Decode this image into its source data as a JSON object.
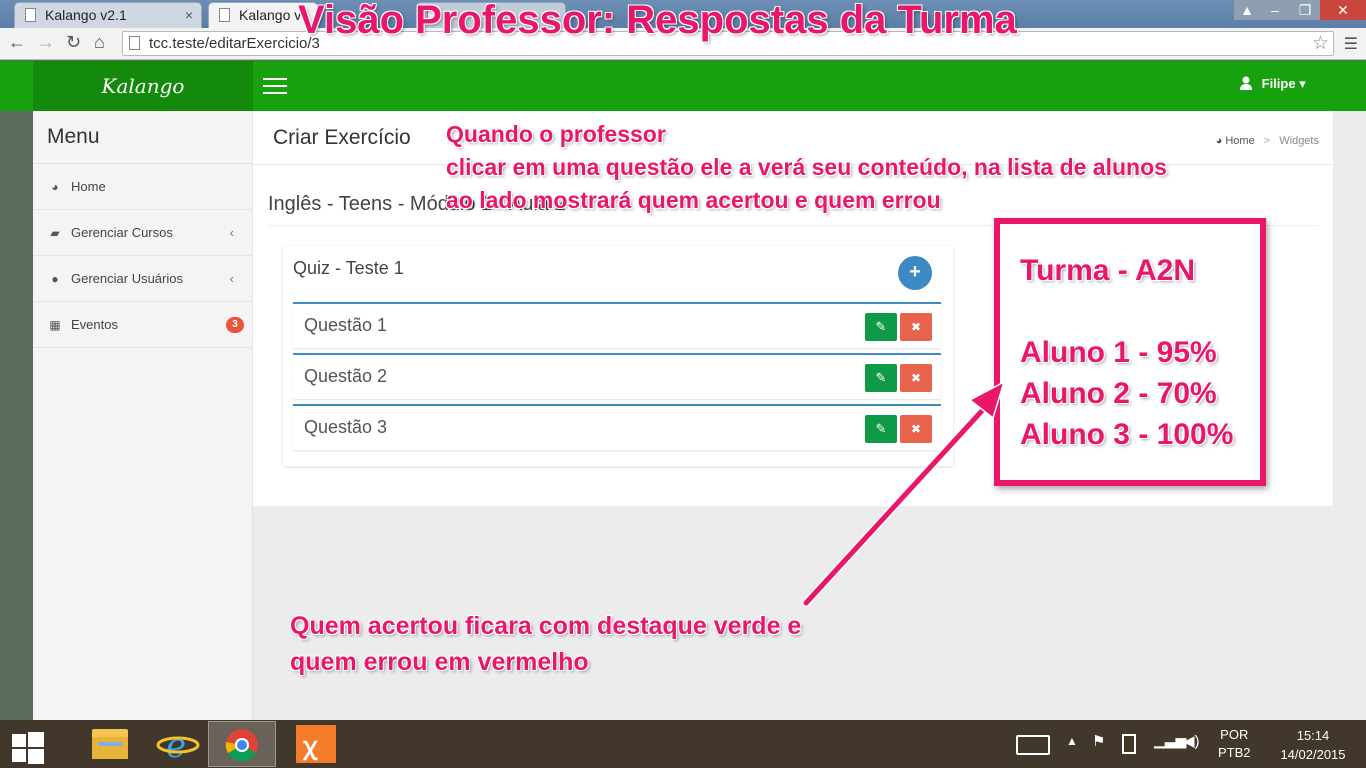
{
  "browser": {
    "tabs": [
      {
        "label": "Kalango v2.1",
        "close": "×"
      },
      {
        "label": "Kalango v",
        "close": ""
      }
    ],
    "url": "tcc.teste/editarExercicio/3",
    "window_colors": {
      "close": "#c9463d"
    }
  },
  "header": {
    "brand": "Kalango",
    "user": "Filipe",
    "accent": "#17a10f"
  },
  "sidebar": {
    "title": "Menu",
    "items": [
      {
        "label": "Home",
        "icon": "dashboard-icon"
      },
      {
        "label": "Gerenciar Cursos",
        "icon": "graduation-cap-icon",
        "chevron": "‹"
      },
      {
        "label": "Gerenciar Usuários",
        "icon": "user-icon",
        "chevron": "‹"
      },
      {
        "label": "Eventos",
        "icon": "calendar-icon",
        "badge": "3"
      }
    ]
  },
  "main": {
    "page_title": "Criar Exercício",
    "breadcrumb": {
      "home": "Home",
      "separator": ">",
      "current": "Widgets"
    },
    "course_title": "Inglês - Teens - Módulo 1 - Aula 2",
    "quiz": {
      "title": "Quiz - Teste 1",
      "add_label": "+",
      "questions": [
        {
          "label": "Questão 1"
        },
        {
          "label": "Questão 2"
        },
        {
          "label": "Questão 3"
        }
      ]
    }
  },
  "annotations": {
    "title": "Visão Professor: Respostas da Turma",
    "note_top": "Quando o professor\nclicar em uma questão ele a verá seu conteúdo, na lista de alunos\nao lado mostrará quem acertou e quem errou",
    "box": {
      "turma": "Turma - A2N",
      "alunos": [
        "Aluno 1 - 95%",
        "Aluno 2 - 70%",
        "Aluno 3 - 100%"
      ]
    },
    "note_bottom": "Quem acertou ficara com destaque verde e\nquem errou em vermelho",
    "color": "#e8176b"
  },
  "taskbar": {
    "apps": [
      "file-explorer-icon",
      "internet-explorer-icon",
      "chrome-icon",
      "xampp-icon"
    ],
    "language": [
      "POR",
      "PTB2"
    ],
    "time": "15:14",
    "date": "14/02/2015"
  }
}
